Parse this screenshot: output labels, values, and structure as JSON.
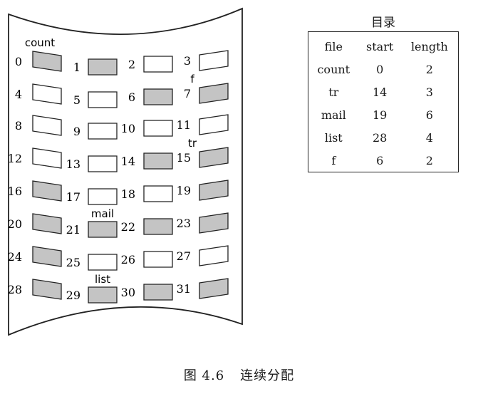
{
  "disk": {
    "blocks": [
      {
        "n": "0",
        "used": true
      },
      {
        "n": "1",
        "used": true
      },
      {
        "n": "2",
        "used": false
      },
      {
        "n": "3",
        "used": false
      },
      {
        "n": "4",
        "used": false
      },
      {
        "n": "5",
        "used": false
      },
      {
        "n": "6",
        "used": true
      },
      {
        "n": "7",
        "used": true
      },
      {
        "n": "8",
        "used": false
      },
      {
        "n": "9",
        "used": false
      },
      {
        "n": "10",
        "used": false
      },
      {
        "n": "11",
        "used": false
      },
      {
        "n": "12",
        "used": false
      },
      {
        "n": "13",
        "used": false
      },
      {
        "n": "14",
        "used": true
      },
      {
        "n": "15",
        "used": true
      },
      {
        "n": "16",
        "used": true
      },
      {
        "n": "17",
        "used": false
      },
      {
        "n": "18",
        "used": false
      },
      {
        "n": "19",
        "used": true
      },
      {
        "n": "20",
        "used": true
      },
      {
        "n": "21",
        "used": true
      },
      {
        "n": "22",
        "used": true
      },
      {
        "n": "23",
        "used": true
      },
      {
        "n": "24",
        "used": true
      },
      {
        "n": "25",
        "used": false
      },
      {
        "n": "26",
        "used": false
      },
      {
        "n": "27",
        "used": false
      },
      {
        "n": "28",
        "used": true
      },
      {
        "n": "29",
        "used": true
      },
      {
        "n": "30",
        "used": true
      },
      {
        "n": "31",
        "used": true
      }
    ],
    "labels": [
      {
        "text": "count",
        "block": 0
      },
      {
        "text": "f",
        "block": 7
      },
      {
        "text": "tr",
        "block": 15
      },
      {
        "text": "mail",
        "block": 21
      },
      {
        "text": "list",
        "block": 29
      }
    ],
    "used_fill": "#c4c4c4",
    "free_fill": "#ffffff"
  },
  "directory": {
    "title": "目录",
    "headers": [
      "file",
      "start",
      "length"
    ],
    "rows": [
      [
        "count",
        "0",
        "2"
      ],
      [
        "tr",
        "14",
        "3"
      ],
      [
        "mail",
        "19",
        "6"
      ],
      [
        "list",
        "28",
        "4"
      ],
      [
        "f",
        "6",
        "2"
      ]
    ]
  },
  "caption": {
    "figure": "图 4.6",
    "title": "连续分配"
  }
}
